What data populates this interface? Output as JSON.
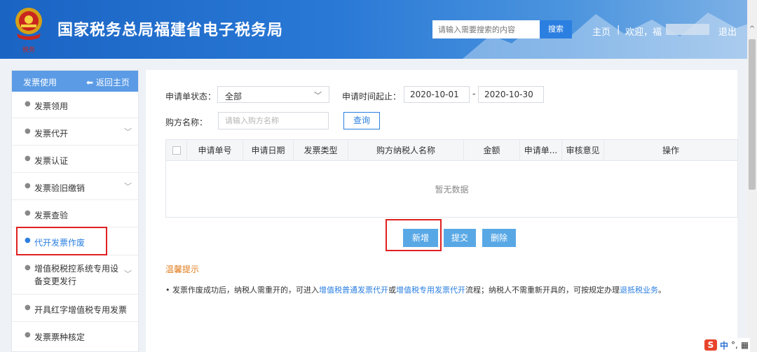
{
  "header": {
    "title": "国家税务总局福建省电子税务局",
    "search_placeholder": "请输入需要搜索的内容",
    "search_button": "搜索",
    "nav_home": "主页",
    "nav_separator": "|",
    "nav_welcome": "欢迎，福",
    "nav_logout": "退出"
  },
  "sidebar": {
    "title": "发票使用",
    "back": "返回主页",
    "items": [
      {
        "label": "发票领用"
      },
      {
        "label": "发票代开"
      },
      {
        "label": "发票认证"
      },
      {
        "label": "发票验旧缴销"
      },
      {
        "label": "发票查验"
      },
      {
        "label": "代开发票作废"
      },
      {
        "label": "增值税税控系统专用设备变更发行"
      },
      {
        "label": "开具红字增值税专用发票"
      },
      {
        "label": "发票票种核定"
      }
    ]
  },
  "filters": {
    "status_label": "申请单状态：",
    "status_value": "全部",
    "date_label": "申请时间起止：",
    "date_from": "2020-10-01",
    "date_dash": "-",
    "date_to": "2020-10-30",
    "buyer_label": "购方名称：",
    "buyer_placeholder": "请输入购方名称",
    "query_button": "查询"
  },
  "table": {
    "columns": [
      "申请单号",
      "申请日期",
      "发票类型",
      "购方纳税人名称",
      "金额",
      "申请单...",
      "审核意见",
      "操作"
    ],
    "empty_text": "暂无数据"
  },
  "actions": {
    "add": "新增",
    "submit": "提交",
    "delete": "删除"
  },
  "tips": {
    "title": "温馨提示",
    "bullet": "•",
    "text_1": "发票作废成功后，纳税人需重开的，可进入",
    "link_1": "增值税普通发票代开",
    "text_2": "或",
    "link_2": "增值税专用发票代开",
    "text_3": "流程；纳税人不需重新开具的，可按规定办理",
    "link_3": "退抵税业务",
    "text_4": "。"
  },
  "ime": {
    "logo": "S",
    "mode": "中",
    "punct": "°,",
    "kbd": "▦"
  },
  "colors": {
    "header_blue": "#1a64c4",
    "sidebar_head": "#5b9be5",
    "button_blue": "#59a8e6",
    "link_blue": "#2b7fe0",
    "tip_orange": "#e07b1a",
    "highlight_red": "#e02020"
  }
}
